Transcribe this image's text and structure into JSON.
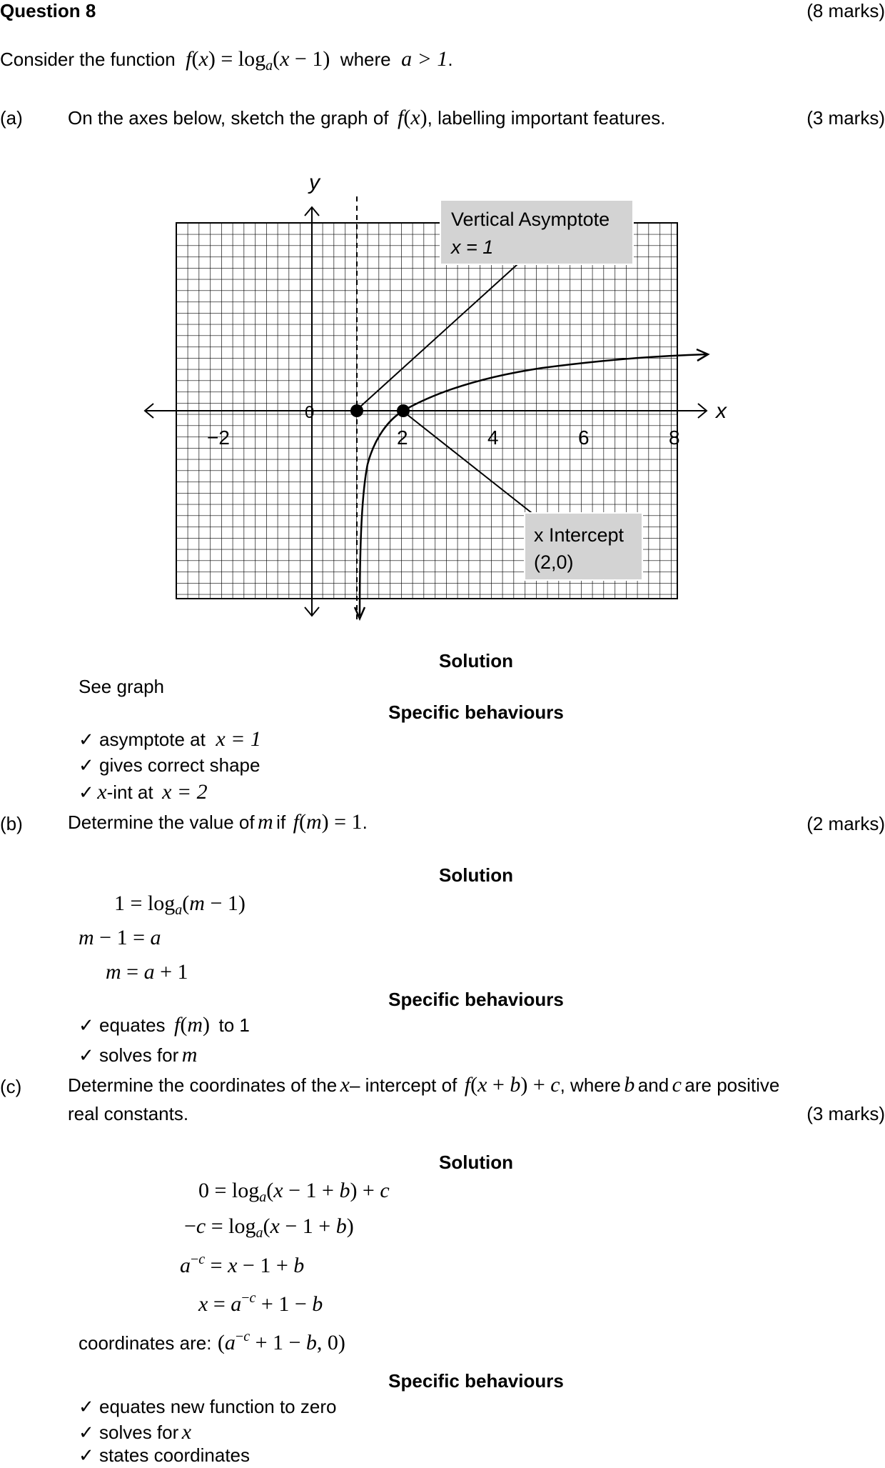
{
  "question": {
    "title": "Question 8",
    "marks": "(8 marks)",
    "intro_text": "Consider the function",
    "intro_where": "where",
    "intro_condition": "a > 1",
    "intro_period": "."
  },
  "part_a": {
    "label": "(a)",
    "text_1": "On the axes below, sketch the graph of",
    "text_2": ", labelling important features.",
    "marks": "(3 marks)",
    "graph": {
      "y_axis_label": "y",
      "x_axis_label": "x",
      "x_ticks": [
        "−2",
        "0",
        "2",
        "4",
        "6",
        "8"
      ],
      "callout_asymptote_line1": "Vertical Asymptote",
      "callout_asymptote_line2": "x = 1",
      "callout_intercept_line1": "x Intercept",
      "callout_intercept_line2": "(2,0)"
    },
    "solution_heading": "Solution",
    "solution_text": "See graph",
    "behaviours_heading": "Specific behaviours",
    "behaviours": [
      "✓ asymptote at",
      "✓ gives correct shape",
      "✓",
      "-int at"
    ],
    "behaviour_1_math": "x = 1",
    "behaviour_3_math": "x = 2"
  },
  "part_b": {
    "label": "(b)",
    "text_1": "Determine the value of",
    "text_var": "m",
    "text_2": "if",
    "text_3": ".",
    "marks": "(2 marks)",
    "solution_heading": "Solution",
    "behaviours_heading": "Specific behaviours",
    "behaviour_1a": "✓ equates",
    "behaviour_1b": "to 1",
    "behaviour_2": "✓ solves for"
  },
  "part_c": {
    "label": "(c)",
    "text_1": "Determine the coordinates of the",
    "text_x": "x",
    "text_2": "– intercept of",
    "text_3": ", where",
    "text_b": "b",
    "text_and": "and",
    "text_c": "c",
    "text_4": "are positive",
    "text_line2": "real constants.",
    "marks": "(3 marks)",
    "solution_heading": "Solution",
    "coordinates_text": "coordinates are:",
    "behaviours_heading": "Specific behaviours",
    "behaviour_1": "✓ equates new function to zero",
    "behaviour_2": "✓ solves for",
    "behaviour_3": "✓ states coordinates"
  }
}
